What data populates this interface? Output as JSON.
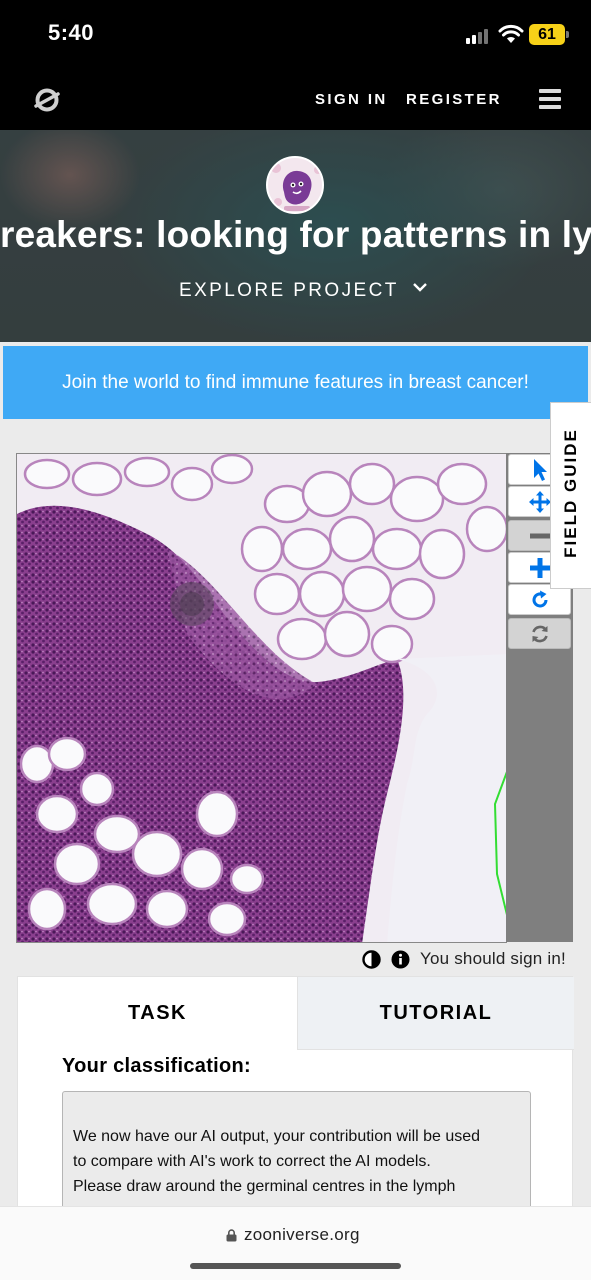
{
  "status_bar": {
    "time": "5:40",
    "battery": "61"
  },
  "nav": {
    "sign_in": "SIGN IN",
    "register": "REGISTER",
    "logo_icon": "zooniverse-logo-icon",
    "menu_icon": "hamburger-menu-icon"
  },
  "project": {
    "title": "reakers: looking for patterns in lym",
    "explore": "EXPLORE PROJECT"
  },
  "banner": {
    "text": "Join the world to find immune features in breast cancer!"
  },
  "field_guide": {
    "label": "FIELD GUIDE"
  },
  "viewer": {
    "tools": [
      "pointer-icon",
      "move-icon",
      "zoom-out-icon",
      "zoom-in-icon",
      "rotate-icon",
      "reset-icon"
    ],
    "accent": "#0074e8",
    "annotation_color": "#33dd33"
  },
  "meta": {
    "sign_in_message": "You should sign in!",
    "icons": [
      "invert-contrast-icon",
      "info-icon"
    ]
  },
  "task": {
    "tabs": [
      "TASK",
      "TUTORIAL"
    ],
    "classification_label": "Your classification:",
    "instruction_lines": [
      "We now have our AI output, your contribution will be used",
      "to compare with AI's work to correct the AI models.",
      "Please draw around the germinal centres in the lymph"
    ]
  },
  "browser": {
    "url": "zooniverse.org"
  }
}
